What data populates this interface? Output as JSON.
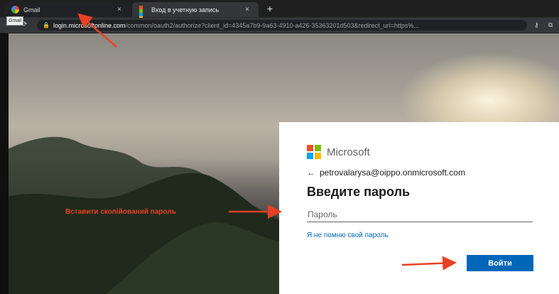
{
  "browser": {
    "tabs": [
      {
        "label": "Gmail",
        "close": "×"
      },
      {
        "label": "Вход в учетную запись",
        "close": "×"
      }
    ],
    "new_tab": "+",
    "tooltip": "Gmail",
    "url_host": "login.microsoftonline.com",
    "url_rest": "/common/oauth2/authorize?client_id=4345a7b9-9a63-4910-a426-35363201d503&redirect_uri=https%...",
    "url_lock_icon": "lock-icon",
    "key_icon": "key-icon"
  },
  "signin": {
    "brand": "Microsoft",
    "back": "←",
    "email": "petrovalarysa@oippo.onmicrosoft.com",
    "title": "Введите пароль",
    "password_placeholder": "Пароль",
    "forgot_link": "Я не помню свой пароль",
    "submit": "Войти"
  },
  "annotation": {
    "label": "Вставити скопійований пароль",
    "arrow_color": "#e84125"
  },
  "colors": {
    "ms_red": "#f25022",
    "ms_green": "#7fba00",
    "ms_blue": "#00a4ef",
    "ms_yellow": "#ffb900",
    "link_blue": "#0067b8",
    "button_blue": "#0067b8"
  }
}
